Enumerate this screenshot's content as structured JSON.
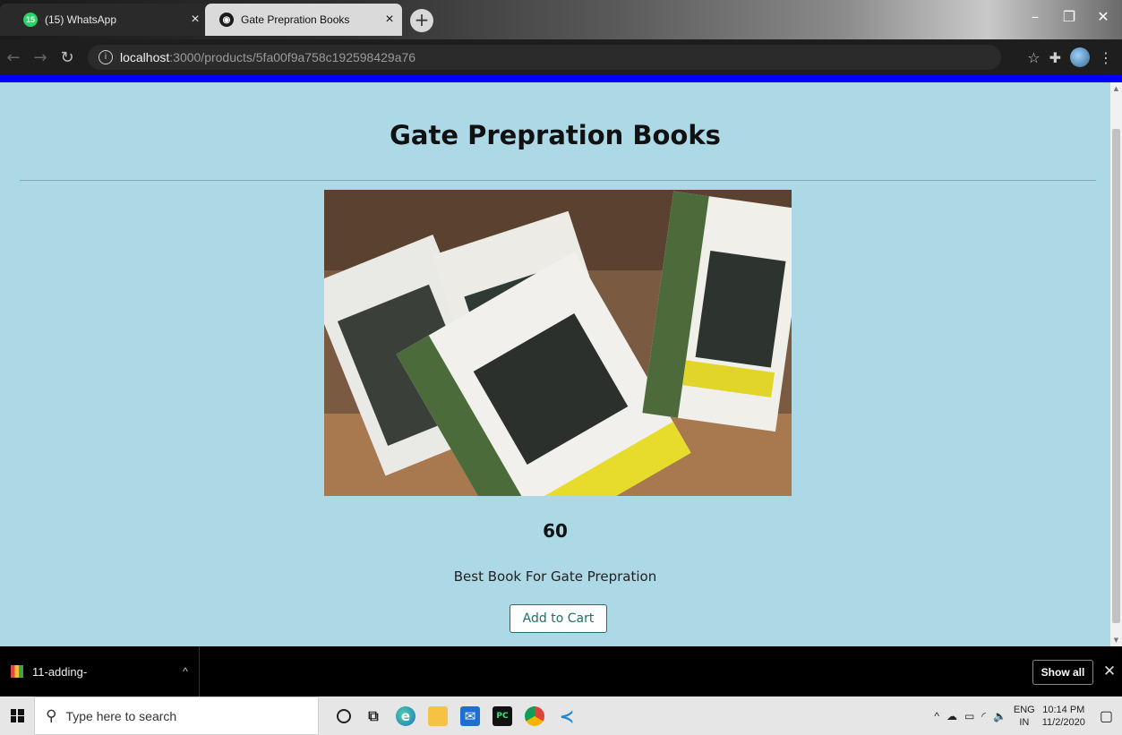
{
  "browser": {
    "tabs": [
      {
        "title": "(15) WhatsApp",
        "favicon": "15"
      },
      {
        "title": "Gate Prepration Books"
      }
    ],
    "new_tab_glyph": "+",
    "url_host": "localhost",
    "url_path": ":3000/products/5fa00f9a758c192598429a76",
    "accent_color": "#0000ff"
  },
  "page": {
    "background": "#add8e6",
    "title": "Gate Prepration Books",
    "product": {
      "price": "60",
      "description": "Best Book For Gate Prepration",
      "add_to_cart_label": "Add to Cart"
    }
  },
  "downloads_bar": {
    "item_name": "11-adding-",
    "show_all_label": "Show all"
  },
  "taskbar": {
    "search_placeholder": "Type here to search",
    "language": "ENG",
    "region": "IN",
    "time": "10:14 PM",
    "date": "11/2/2020"
  }
}
